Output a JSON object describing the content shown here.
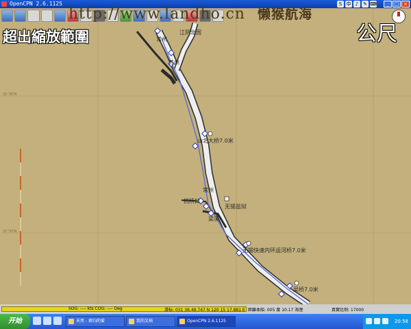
{
  "window": {
    "title": "OpenCPN 2.6.1125"
  },
  "titlebar_tray": [
    "S",
    "中",
    "♪",
    "✎",
    "⌨"
  ],
  "window_controls": [
    "_",
    "□",
    "×"
  ],
  "toolbar": {
    "buttons": [
      "zoom-in",
      "zoom-out",
      "scale-in",
      "scale-out",
      "route",
      "waypoint",
      "follow",
      "settings",
      "text",
      "current",
      "tide",
      "print",
      "ais",
      "info",
      "track",
      "chart-quilt",
      "mob",
      "about"
    ]
  },
  "overlay": {
    "watermark_url": "http://www.landho.cn",
    "watermark_name": "懒猴航海",
    "overzoom_text": "超出縮放範圍",
    "unit_text": "公尺"
  },
  "map_labels": [
    "江阴北国",
    "常州",
    "苏州",
    "山北大桥7.0米",
    "常州",
    "无锡监狱",
    "梁溪",
    "抗桥口",
    "无锡快速内环运河桥7.0米",
    "吴桥7.0米"
  ],
  "grid_labels": [
    "31°30'N",
    "31°30'N"
  ],
  "status": {
    "progress": 1.0,
    "sog": "SOG: ----  kts  COG: ----  Deg",
    "position": "游标: 031 36.49.747 N 120 15 17.881 E",
    "distance": "距離本船: 005 度    10.17 海浬",
    "scale": "真實比例:    17000"
  },
  "taskbar": {
    "start_label": "开始",
    "tasks": [
      "天亮 - 君归的爱",
      "我的文档",
      "OpenCPN 2.6.1125"
    ],
    "clock": "20:58"
  },
  "colors": {
    "sea": "#c3b07c",
    "channel": "#eeeeee",
    "route": "#5a6bd8",
    "progress": "#e7d51a"
  }
}
